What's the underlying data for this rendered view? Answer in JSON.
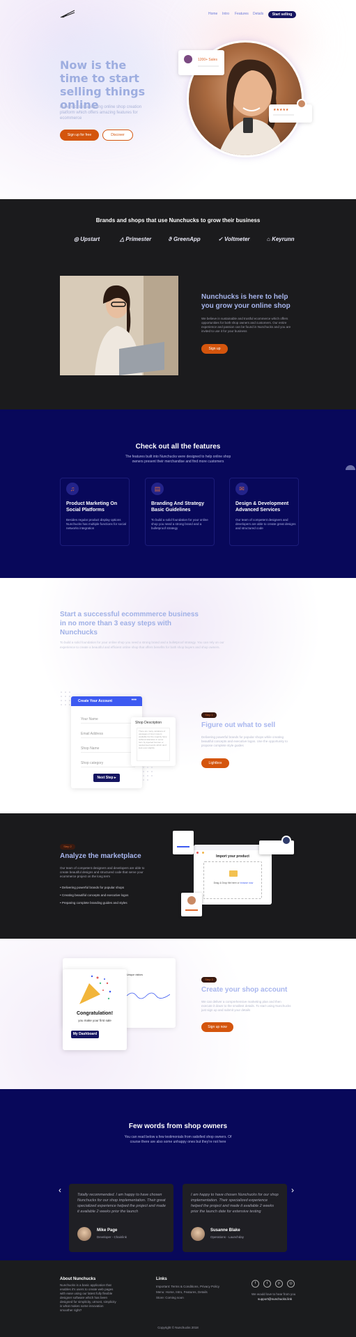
{
  "nav": {
    "links": [
      "Home",
      "Intro",
      "Features",
      "Details"
    ],
    "cta": "Start selling"
  },
  "hero": {
    "title": "Now is the time to start selling things online",
    "subtitle": "Nunchucks is a leading online shop creation platform which offers amazing features for ecommerce",
    "btn_primary": "Sign up for free",
    "btn_secondary": "Discover",
    "badge_sales": "1200+ Sales",
    "rating_stars": "★★★★★"
  },
  "brands": {
    "title": "Brands and shops that use Nunchucks to grow their business",
    "items": [
      "Upstart",
      "Primester",
      "GreenApp",
      "Voltmeter",
      "Keyrunn"
    ]
  },
  "about": {
    "title": "Nunchucks is here to help you grow your online shop",
    "text": "We believe in sustainable and trustful ecommerce which offers opportunities for both shop owners and customers. Our entire experience and passion can be found in Nunchucks and you are invited to use it for your business",
    "btn": "Sign up"
  },
  "features": {
    "title": "Check out all the features",
    "subtitle": "The features built into Nunchucks were designed to help online shop owners present their merchandise and find more customers",
    "cards": [
      {
        "icon": "headphones-icon",
        "glyph": "♫",
        "title": "Product Marketing On Social Platforms",
        "text": "Besides regular product display options Nunchucks has multiple functions for social networks integration"
      },
      {
        "icon": "clipboard-icon",
        "glyph": "▤",
        "title": "Branding And Strategy Basic Guidelines",
        "text": "To build a solid foundation for your online shop you need a strong brand and a bulletproof strategy"
      },
      {
        "icon": "chat-icon",
        "glyph": "✉",
        "title": "Design & Development Advanced Services",
        "text": "Our team of competent designers and developers are able to create great designs and structured code"
      }
    ]
  },
  "steps_intro": {
    "title": "Start a successful ecommmerce business in no more than 3 easy steps with Nunchucks",
    "text": "To build a solid foundation for your online shop you need a strong brand and a bulletproof strategy. You can rely on our experience to create a beautiful and efficient online shop that offers benefits for both shop buyers and shop owners."
  },
  "form": {
    "header": "Create Your Account",
    "fields": [
      "Your Name",
      "Email Address",
      "Shop Name",
      "Shop category"
    ],
    "btn": "Next Step ▸",
    "desc_title": "Shop Description",
    "desc_text": "There are many variations of passages of lorem ipsum available but the majority have suffered alteration in some form by injected humour or randomised words which don't look even slightly"
  },
  "step1": {
    "badge": "Step 1",
    "title": "Figure out what to sell",
    "text": "Delivering powerful brands for popular shops while creating beautiful concepts and executive logos. Use the opportunity to propose complete style guides",
    "btn": "Lightbox"
  },
  "step2": {
    "badge": "Step 2",
    "title": "Analyze the marketplace",
    "text": "Our team of competent designers and developers are able to create beautiful designs and structured code that serve your ecommerce project on the long term",
    "bullets": [
      "Delivering powerful brands for popular shops",
      "Creating beautiful concepts and executive logos",
      "Preparing complete branding guides and styles"
    ],
    "import_title": "Import your product",
    "drop_text": "Drag & Drop file here or",
    "browse": "browse now"
  },
  "step3": {
    "badge": "Step 3",
    "title": "Create your shop account",
    "text": "We can deliver a comprehensive marketing plan and then execute it down to the smallest details. To start using Nunchucks just sign up and submit your details",
    "btn": "Sign up now",
    "congrats": "Congratulation!",
    "congrats_sub": "you make your first sale",
    "dash_btn": "My Dashboard",
    "chart_label": "Unique visitors"
  },
  "testimonials": {
    "title": "Few words from shop owners",
    "subtitle": "You can read below a few testimonials from satisfied shop owners. Of course there are also some unhappy ones but they're not here",
    "items": [
      {
        "quote": "Totally recommended. I am happy to have chosen Nunchucks for our shop implementation. Their great specialized experience helped the project and made it available 2 weeks prior the launch",
        "name": "Mike Page",
        "role": "Developer - Chainlink"
      },
      {
        "quote": "I am happy to have chosen Nunchucks for our shop implementation. Their specialized experience helped the project and made it available 2 weeks prior the launch date for extensive testing",
        "name": "Susanne Blake",
        "role": "Operations - Launchday"
      }
    ]
  },
  "footer": {
    "about_title": "About Nunchucks",
    "about_text": "Nunchucks is a basic application that enables it's users to create web pages with ease using our latest fully flexible designer software which has been designed for simplicity, utmost, simplicity is what makes some innovation smoother right?",
    "links_title": "Links",
    "links_1": "Important: Terms & Conditions, Privacy Policy",
    "links_2": "Menu: Home, Intro, Features, Details",
    "links_3": "Store: Coming soon",
    "contact_text": "We would love to hear from you",
    "email": "support@nunchucks.link",
    "copyright": "Copyright © Nunchucks 2018"
  }
}
